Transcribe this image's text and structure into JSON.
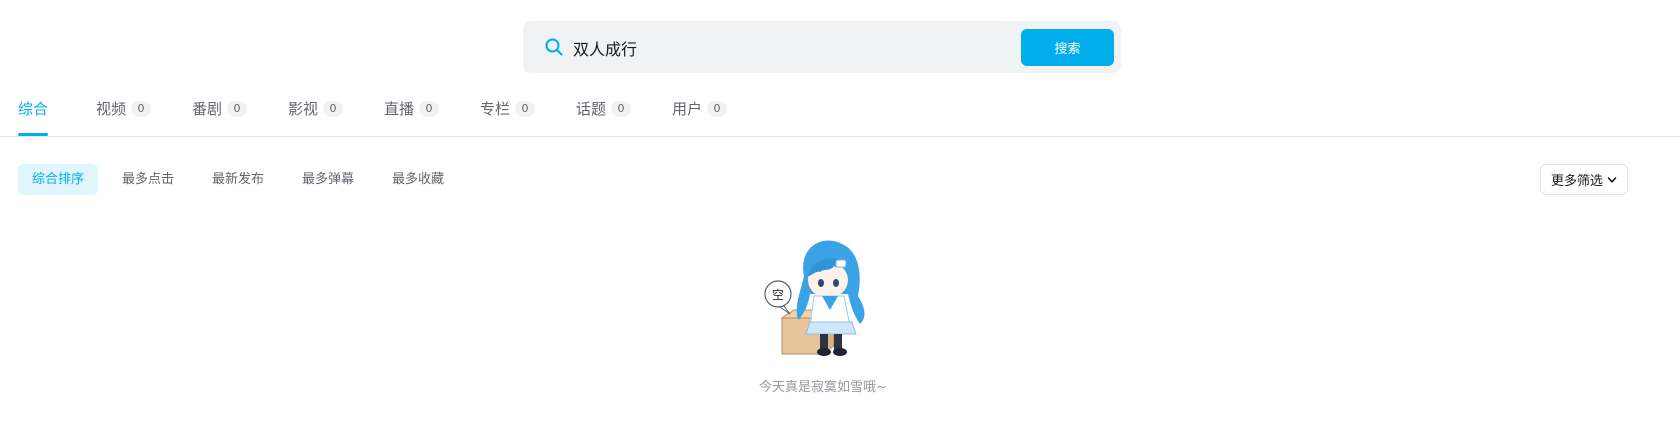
{
  "search": {
    "value": "双人成行",
    "button_label": "搜索"
  },
  "tabs": [
    {
      "label": "综合",
      "count": null,
      "active": true
    },
    {
      "label": "视频",
      "count": "0"
    },
    {
      "label": "番剧",
      "count": "0"
    },
    {
      "label": "影视",
      "count": "0"
    },
    {
      "label": "直播",
      "count": "0"
    },
    {
      "label": "专栏",
      "count": "0"
    },
    {
      "label": "话题",
      "count": "0"
    },
    {
      "label": "用户",
      "count": "0"
    }
  ],
  "sort": {
    "items": [
      "综合排序",
      "最多点击",
      "最新发布",
      "最多弹幕",
      "最多收藏"
    ],
    "active_index": 0,
    "more_filter_label": "更多筛选"
  },
  "empty": {
    "bubble_text": "空",
    "message": "今天真是寂寞如雪哦~"
  },
  "colors": {
    "accent": "#00aeec",
    "text_secondary": "#61666d",
    "muted": "#9499a0"
  },
  "icons": {
    "search": "search-icon",
    "more_filter": "chevron-down-icon"
  }
}
